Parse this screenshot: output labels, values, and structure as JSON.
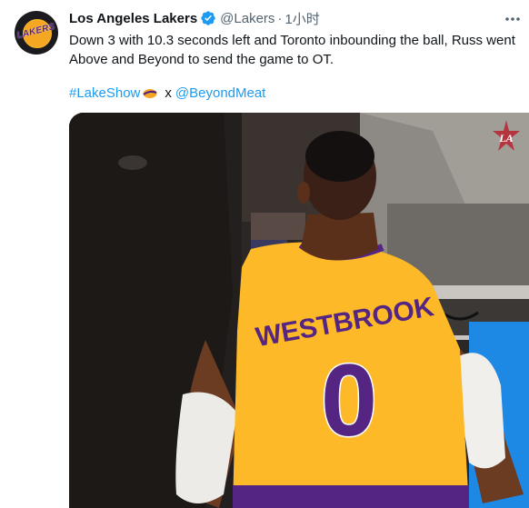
{
  "tweet": {
    "author_name": "Los Angeles Lakers",
    "handle": "@Lakers",
    "separator": "·",
    "time": "1小时",
    "text": "Down 3 with 10.3 seconds left and Toronto inbounding the ball, Russ went Above and Beyond to send the game to OT.",
    "hashtag": "#LakeShow",
    "connector": "x",
    "mention": "@BeyondMeat",
    "avatar_text": "LAKERS"
  },
  "media": {
    "jersey_name": "WESTBROOK",
    "jersey_number": "0",
    "corner_logo": "LA"
  },
  "colors": {
    "link": "#1d9bf0",
    "verified": "#1d9bf0",
    "lakers_gold": "#fdb927",
    "lakers_purple": "#552583"
  },
  "icons": [
    "verified-badge-icon",
    "more-options-icon",
    "basketball-emoji-icon"
  ]
}
